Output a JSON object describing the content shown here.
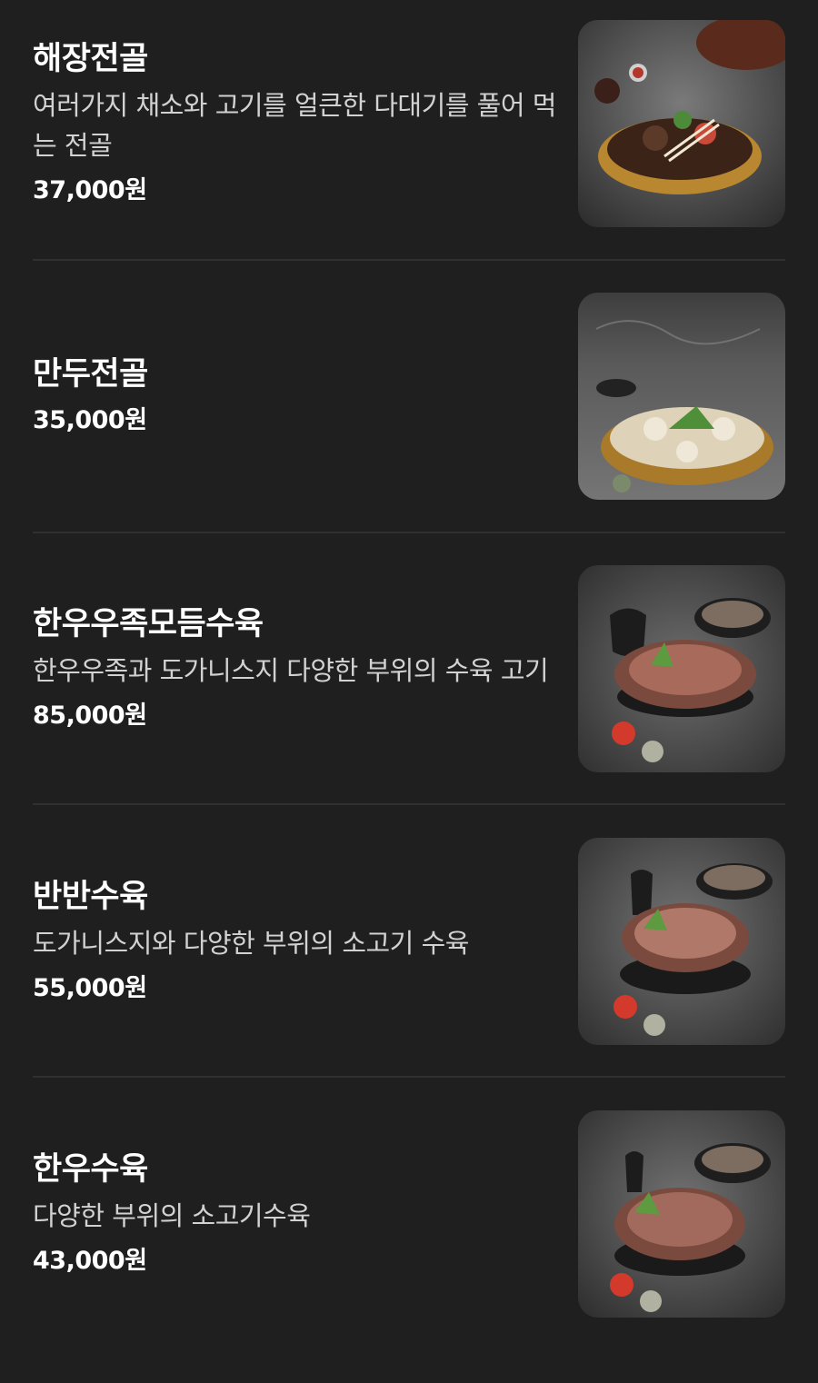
{
  "menu": {
    "items": [
      {
        "name": "해장전골",
        "description": "여러가지 채소와 고기를 얼큰한 다대기를 풀어 먹는 전골",
        "price": "37,000원",
        "image_icon": "hotpot-photo-icon"
      },
      {
        "name": "만두전골",
        "description": "",
        "price": "35,000원",
        "image_icon": "dumpling-hotpot-photo-icon"
      },
      {
        "name": "한우우족모듬수육",
        "description": "한우우족과 도가니스지 다양한 부위의 수육 고기",
        "price": "85,000원",
        "image_icon": "boiled-beef-platter-photo-icon"
      },
      {
        "name": "반반수육",
        "description": "도가니스지와 다양한 부위의 소고기 수육",
        "price": "55,000원",
        "image_icon": "half-half-suyuk-photo-icon"
      },
      {
        "name": "한우수육",
        "description": "다양한 부위의 소고기수육",
        "price": "43,000원",
        "image_icon": "hanwoo-suyuk-photo-icon"
      }
    ]
  },
  "colors": {
    "background": "#1f1f1f",
    "text": "#ffffff",
    "description": "#d2d2d2",
    "divider": "#303030"
  }
}
